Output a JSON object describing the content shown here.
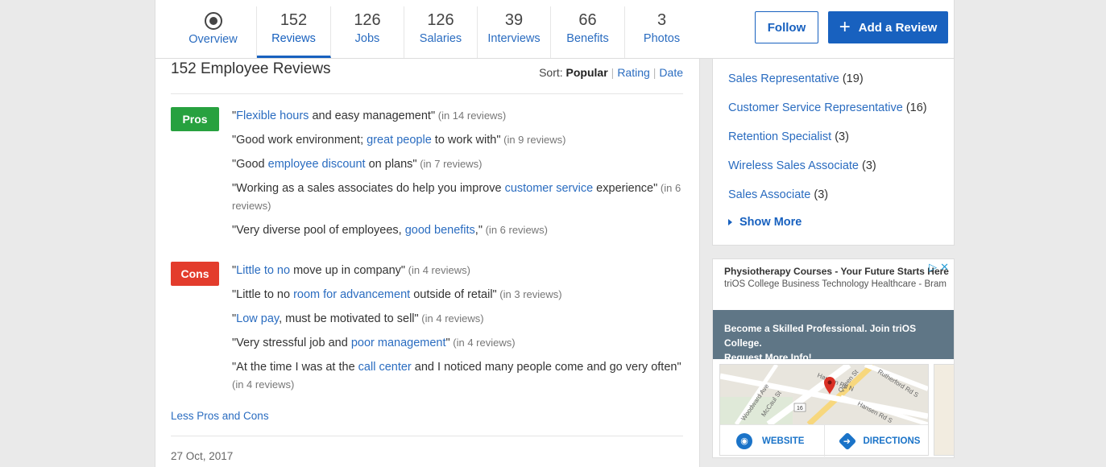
{
  "tabs": [
    {
      "count": "",
      "label": "Overview",
      "active": false
    },
    {
      "count": "152",
      "label": "Reviews",
      "active": true
    },
    {
      "count": "126",
      "label": "Jobs",
      "active": false
    },
    {
      "count": "126",
      "label": "Salaries",
      "active": false
    },
    {
      "count": "39",
      "label": "Interviews",
      "active": false
    },
    {
      "count": "66",
      "label": "Benefits",
      "active": false
    },
    {
      "count": "3",
      "label": "Photos",
      "active": false
    }
  ],
  "header": {
    "follow_label": "Follow",
    "add_review_label": "Add a Review"
  },
  "reviews": {
    "title": "152 Employee Reviews",
    "sort_label": "Sort:",
    "sort_popular": "Popular",
    "sort_rating": "Rating",
    "sort_date": "Date",
    "pros_label": "Pros",
    "cons_label": "Cons",
    "pros": [
      {
        "pre": "\"",
        "link": "Flexible hours",
        "post": " and easy management\"",
        "count": " (in 14 reviews)"
      },
      {
        "pre": "\"Good work environment; ",
        "link": "great people",
        "post": " to work with\"",
        "count": " (in 9 reviews)"
      },
      {
        "pre": "\"Good ",
        "link": "employee discount",
        "post": " on plans\"",
        "count": " (in 7 reviews)"
      },
      {
        "pre": "\"Working as a sales associates do help you improve ",
        "link": "customer service",
        "post": " experience\"",
        "count": " (in 6 reviews)"
      },
      {
        "pre": "\"Very diverse pool of employees, ",
        "link": "good benefits",
        "post": ",\"",
        "count": " (in 6 reviews)"
      }
    ],
    "cons": [
      {
        "pre": "\"",
        "link": "Little to no",
        "post": " move up in company\"",
        "count": " (in 4 reviews)"
      },
      {
        "pre": "\"Little to no ",
        "link": "room for advancement",
        "post": " outside of retail\"",
        "count": " (in 3 reviews)"
      },
      {
        "pre": "\"",
        "link": "Low pay",
        "post": ", must be motivated to sell\"",
        "count": " (in 4 reviews)"
      },
      {
        "pre": "\"Very stressful job and ",
        "link": "poor management",
        "post": "\"",
        "count": " (in 4 reviews)"
      },
      {
        "pre": "\"At the time I was at the ",
        "link": "call center",
        "post": " and I noticed many people come and go very often\"",
        "count": " (in 4 reviews)"
      }
    ],
    "less_link": "Less Pros and Cons",
    "review_date": "27 Oct, 2017"
  },
  "jobs": {
    "items": [
      {
        "title": "Sales Representative",
        "count": " (19)"
      },
      {
        "title": "Customer Service Representative",
        "count": " (16)"
      },
      {
        "title": "Retention Specialist",
        "count": " (3)"
      },
      {
        "title": "Wireless Sales Associate",
        "count": " (3)"
      },
      {
        "title": "Sales Associate",
        "count": " (3)"
      }
    ],
    "show_more": "Show More"
  },
  "ad": {
    "title": "Physiotherapy Courses - Your Future Starts Here",
    "subtitle": "triOS College Business Technology Healthcare - Bram",
    "band_line1": "Become a Skilled Professional. Join triOS College.",
    "band_line2": "Request More Info!",
    "website": "WEBSITE",
    "directions": "DIRECTIONS",
    "map_labels": [
      "Hansen Rd N",
      "Queen St",
      "Rutherford Rd S",
      "Woodward Ave",
      "McCaul St",
      "Hansen Rd S",
      "16"
    ]
  },
  "colors": {
    "accent": "#1861bf",
    "link": "#2a6cc0",
    "pros": "#27a13f",
    "cons": "#e33c2c"
  }
}
